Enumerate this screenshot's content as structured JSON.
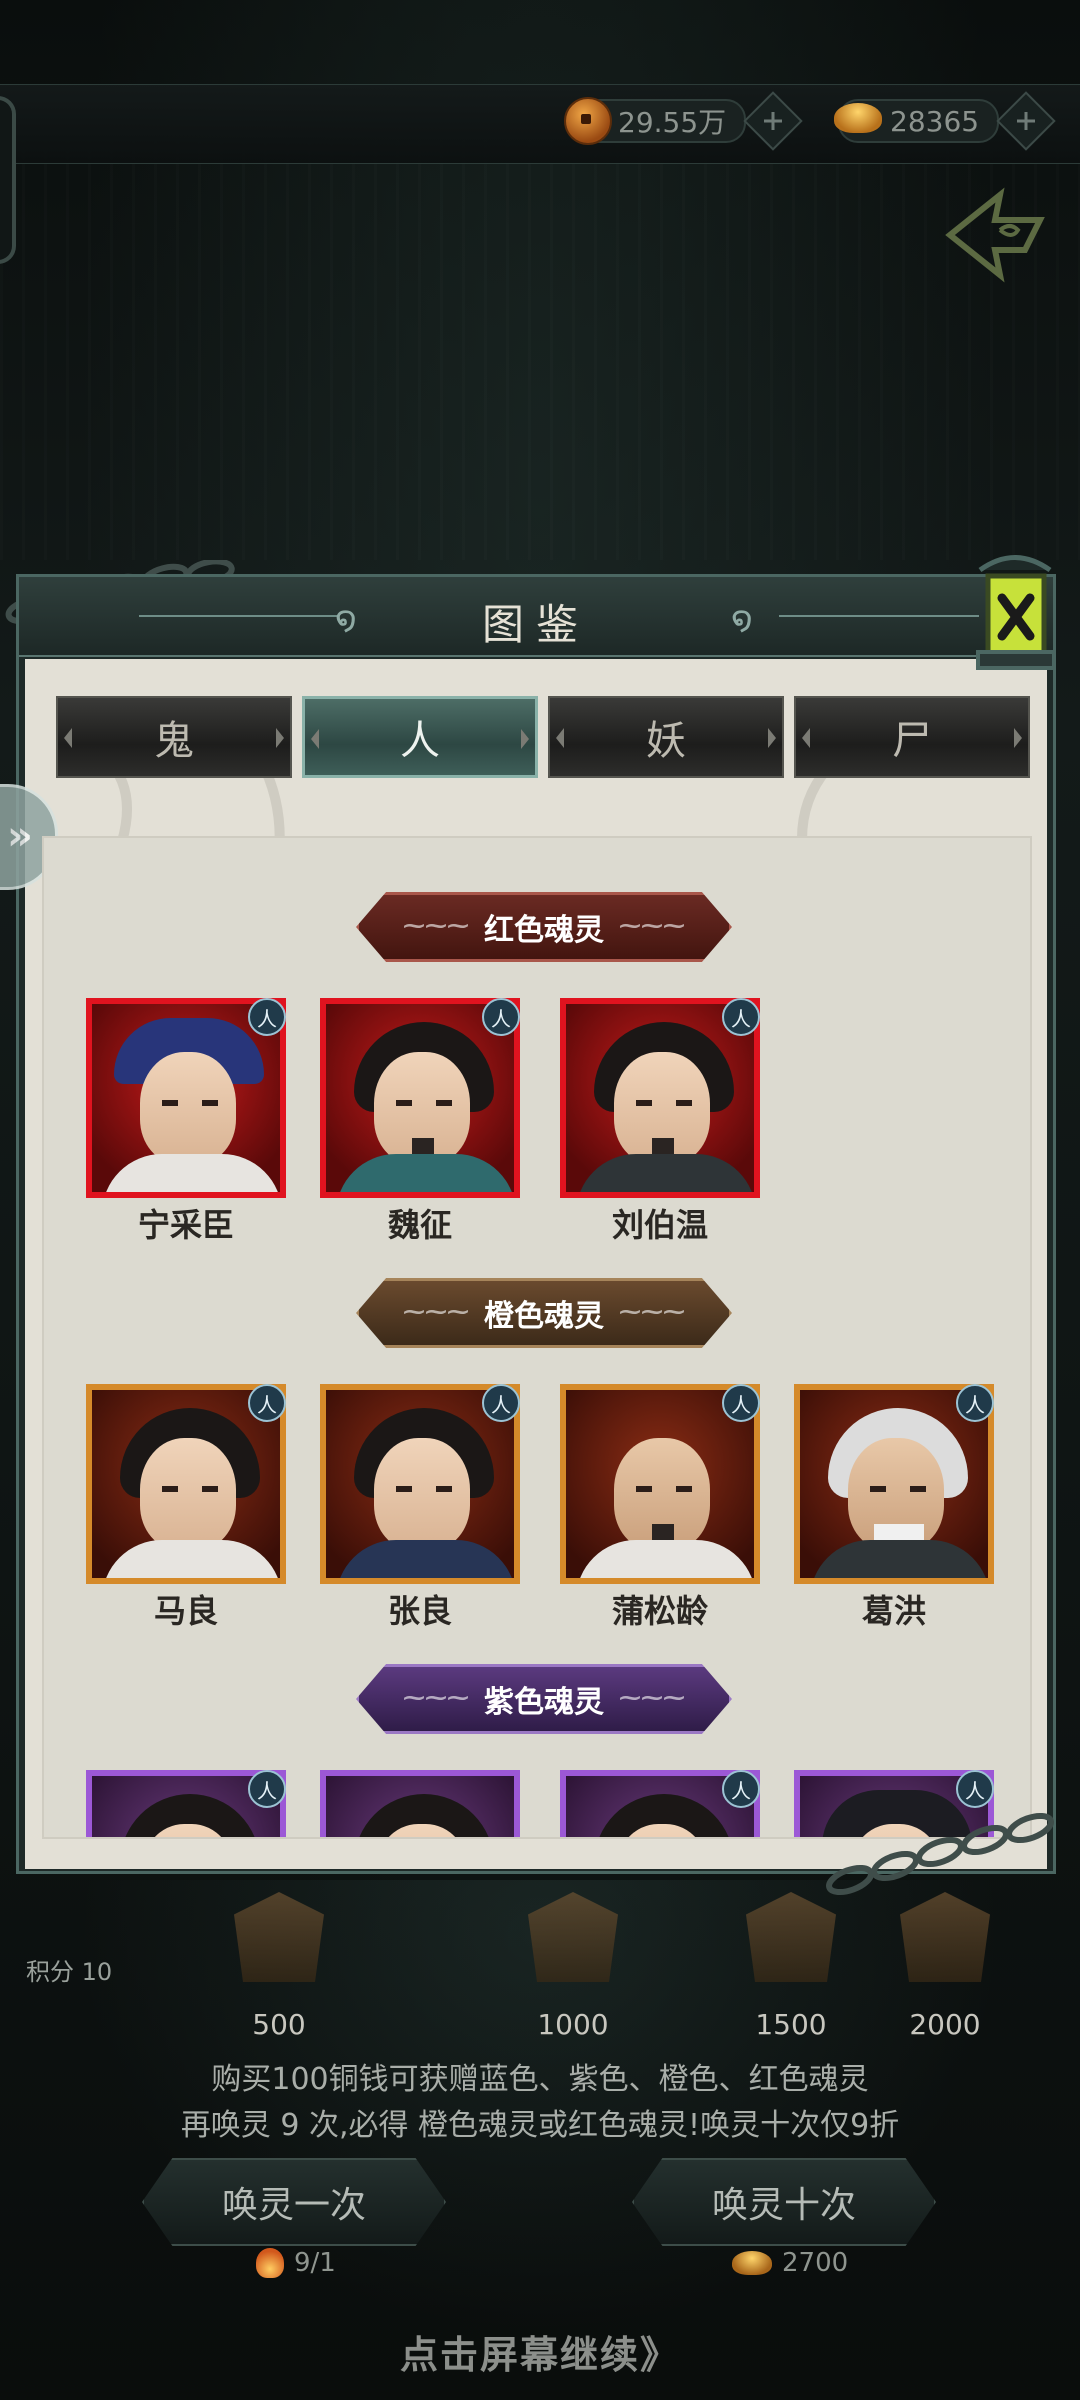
{
  "currency": {
    "copper": "29.55万",
    "gold": "28365"
  },
  "dialog": {
    "title": "图鉴",
    "tabs": [
      {
        "label": "鬼",
        "active": false
      },
      {
        "label": "人",
        "active": true
      },
      {
        "label": "妖",
        "active": false
      },
      {
        "label": "尸",
        "active": false
      }
    ]
  },
  "sections": [
    {
      "banner": "红色魂灵",
      "rarity_color": "#e0131f",
      "cards": [
        {
          "name": "宁采臣",
          "badge": "人"
        },
        {
          "name": "魏征",
          "badge": "人"
        },
        {
          "name": "刘伯温",
          "badge": "人"
        }
      ]
    },
    {
      "banner": "橙色魂灵",
      "rarity_color": "#d58a2a",
      "cards": [
        {
          "name": "马良",
          "badge": "人"
        },
        {
          "name": "张良",
          "badge": "人"
        },
        {
          "name": "蒲松龄",
          "badge": "人"
        },
        {
          "name": "葛洪",
          "badge": "人"
        }
      ]
    },
    {
      "banner": "紫色魂灵",
      "rarity_color": "#9c58d6",
      "cards": [
        {
          "name": "",
          "badge": "人"
        },
        {
          "name": "",
          "badge": ""
        },
        {
          "name": "",
          "badge": "人"
        },
        {
          "name": "",
          "badge": "人"
        }
      ]
    }
  ],
  "score": {
    "label": "积分 10",
    "milestones": [
      "500",
      "1000",
      "1500",
      "2000"
    ]
  },
  "info": {
    "line1": "购买100铜钱可获赠蓝色、紫色、橙色、红色魂灵",
    "line2": "再唤灵 9 次,必得 橙色魂灵或红色魂灵!唤灵十次仅9折"
  },
  "summon": {
    "once_label": "唤灵一次",
    "once_cost": "9/1",
    "ten_label": "唤灵十次",
    "ten_cost": "2700"
  },
  "continue_text": "点击屏幕继续》"
}
